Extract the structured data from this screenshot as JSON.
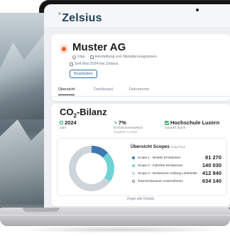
{
  "app": {
    "logo_mark": "°",
    "logo_text": "Zelsius"
  },
  "company": {
    "name": "Muster AG",
    "location": "Visp",
    "industry": "Herstellung von Metallerzeugnissen",
    "since": "Seit Mai 2024 bei Zelsius",
    "edit_label": "Bearbeiten"
  },
  "tabs": [
    {
      "label": "Übersicht",
      "active": true
    },
    {
      "label": "Dashboard",
      "active": false
    },
    {
      "label": "Dokumente",
      "active": false
    }
  ],
  "bilanz": {
    "title_main": "CO",
    "title_sub": "2",
    "title_rest": "-Bilanz",
    "kpis": {
      "year": {
        "value": "2024",
        "label": "Jahr"
      },
      "reduction": {
        "value": "7%",
        "label": "Emissionsreduktion",
        "sub": "Vergleich zu 2023"
      },
      "auditor": {
        "value": "Hochschule Luzern",
        "label": "Geprüft durch"
      }
    }
  },
  "scopes": {
    "title": "Übersicht Scopes",
    "unit": "in kg CO₂e",
    "details_label": "Zeige alle Details",
    "rows": [
      {
        "name": "Scope 1 - Direkte Emissionen",
        "value": "81 270",
        "color": "#3d78b0"
      },
      {
        "name": "Scope 2 - Indirekte Emissionen",
        "value": "140 030",
        "color": "#6fd3d6"
      },
      {
        "name": "Scope 3 - Emissionen entlang Lieferkette",
        "value": "412 840",
        "color": "#cfd4da"
      },
      {
        "name": "Total Emissionen Unternehmen",
        "value": "634 140",
        "color": "#ffffff"
      }
    ]
  },
  "chart_data": {
    "type": "pie",
    "categories": [
      "Scope 1 - Direkte Emissionen",
      "Scope 2 - Indirekte Emissionen",
      "Scope 3 - Emissionen entlang Lieferkette"
    ],
    "values": [
      81270,
      140030,
      412840
    ],
    "colors": [
      "#3d78b0",
      "#6fd3d6",
      "#cfd4da"
    ]
  },
  "colors": {
    "accent": "#2f6ea3",
    "success": "#3fb06a",
    "brand": "#1f4257"
  }
}
